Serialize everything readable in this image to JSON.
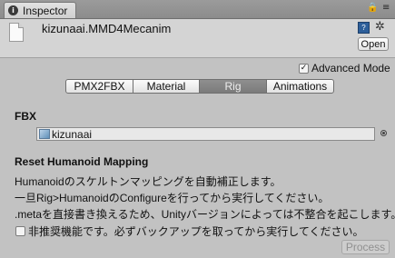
{
  "tab": {
    "label": "Inspector",
    "icon": "info-icon"
  },
  "toolbar": {
    "lock_icon": "🔒",
    "menu_icon": "≡"
  },
  "header": {
    "title": "kizunaai.MMD4Mecanim",
    "help_icon": "?",
    "gear_icon": "✲",
    "open_label": "Open"
  },
  "advanced": {
    "label": "Advanced Mode",
    "checked": true,
    "check_glyph": "✓"
  },
  "tabs": [
    {
      "label": "PMX2FBX",
      "active": false
    },
    {
      "label": "Material",
      "active": false
    },
    {
      "label": "Rig",
      "active": true
    },
    {
      "label": "Animations",
      "active": false
    }
  ],
  "fbx": {
    "heading": "FBX",
    "value": "kizunaai"
  },
  "mapping": {
    "heading": "Reset Humanoid Mapping",
    "lines": [
      "Humanoidのスケルトンマッピングを自動補正します。",
      "一旦Rig>HumanoidのConfigureを行ってから実行してください。",
      ".metaを直接書き換えるため、Unityバージョンによっては不整合を起こします。"
    ],
    "warning_label": "非推奨機能です。必ずバックアップを取ってから実行してください。",
    "warning_checked": false,
    "process_label": "Process"
  }
}
